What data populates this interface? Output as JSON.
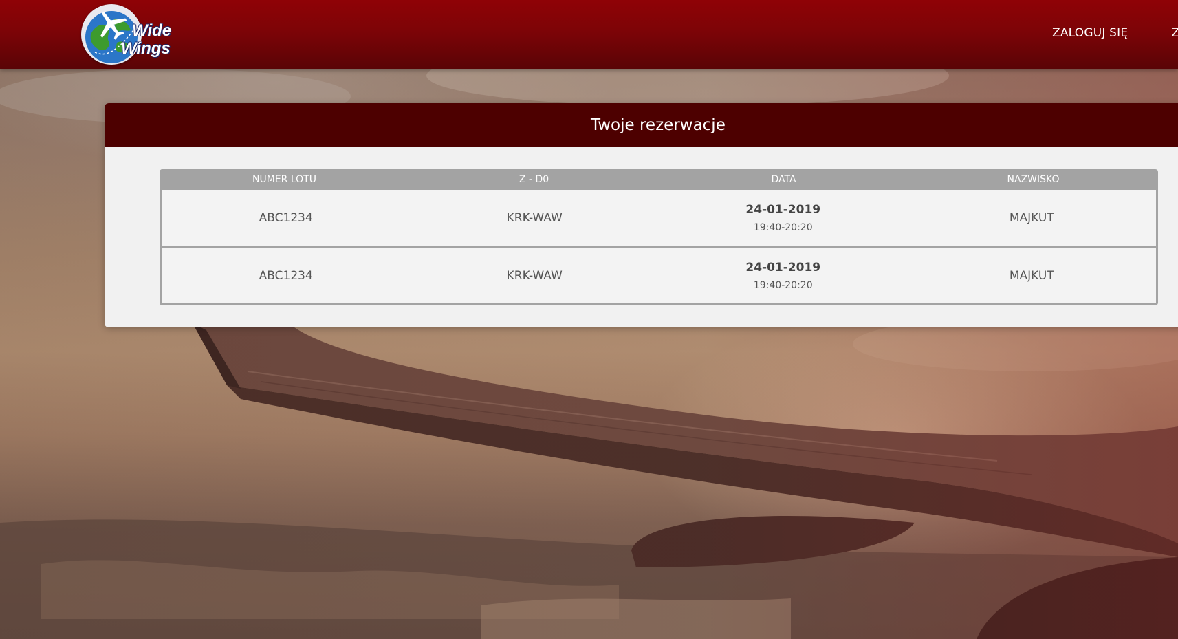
{
  "header": {
    "logo": {
      "icon": "globe-plane-logo",
      "line1": "Wide",
      "line2": "Wings"
    },
    "nav": [
      {
        "label": "ZALOGUJ SIĘ"
      },
      {
        "label": "Z"
      }
    ]
  },
  "reservations": {
    "title": "Twoje rezerwacje",
    "columns": [
      "NUMER LOTU",
      "Z - D0",
      "DATA",
      "NAZWISKO"
    ],
    "rows": [
      {
        "flight": "ABC1234",
        "route": "KRK-WAW",
        "date": "24-01-2019",
        "time": "19:40-20:20",
        "surname": "MAJKUT"
      },
      {
        "flight": "ABC1234",
        "route": "KRK-WAW",
        "date": "24-01-2019",
        "time": "19:40-20:20",
        "surname": "MAJKUT"
      }
    ]
  },
  "colors": {
    "header_red": "#8f0206",
    "panel_header": "#4d0000",
    "table_header": "#a3a3a3"
  }
}
